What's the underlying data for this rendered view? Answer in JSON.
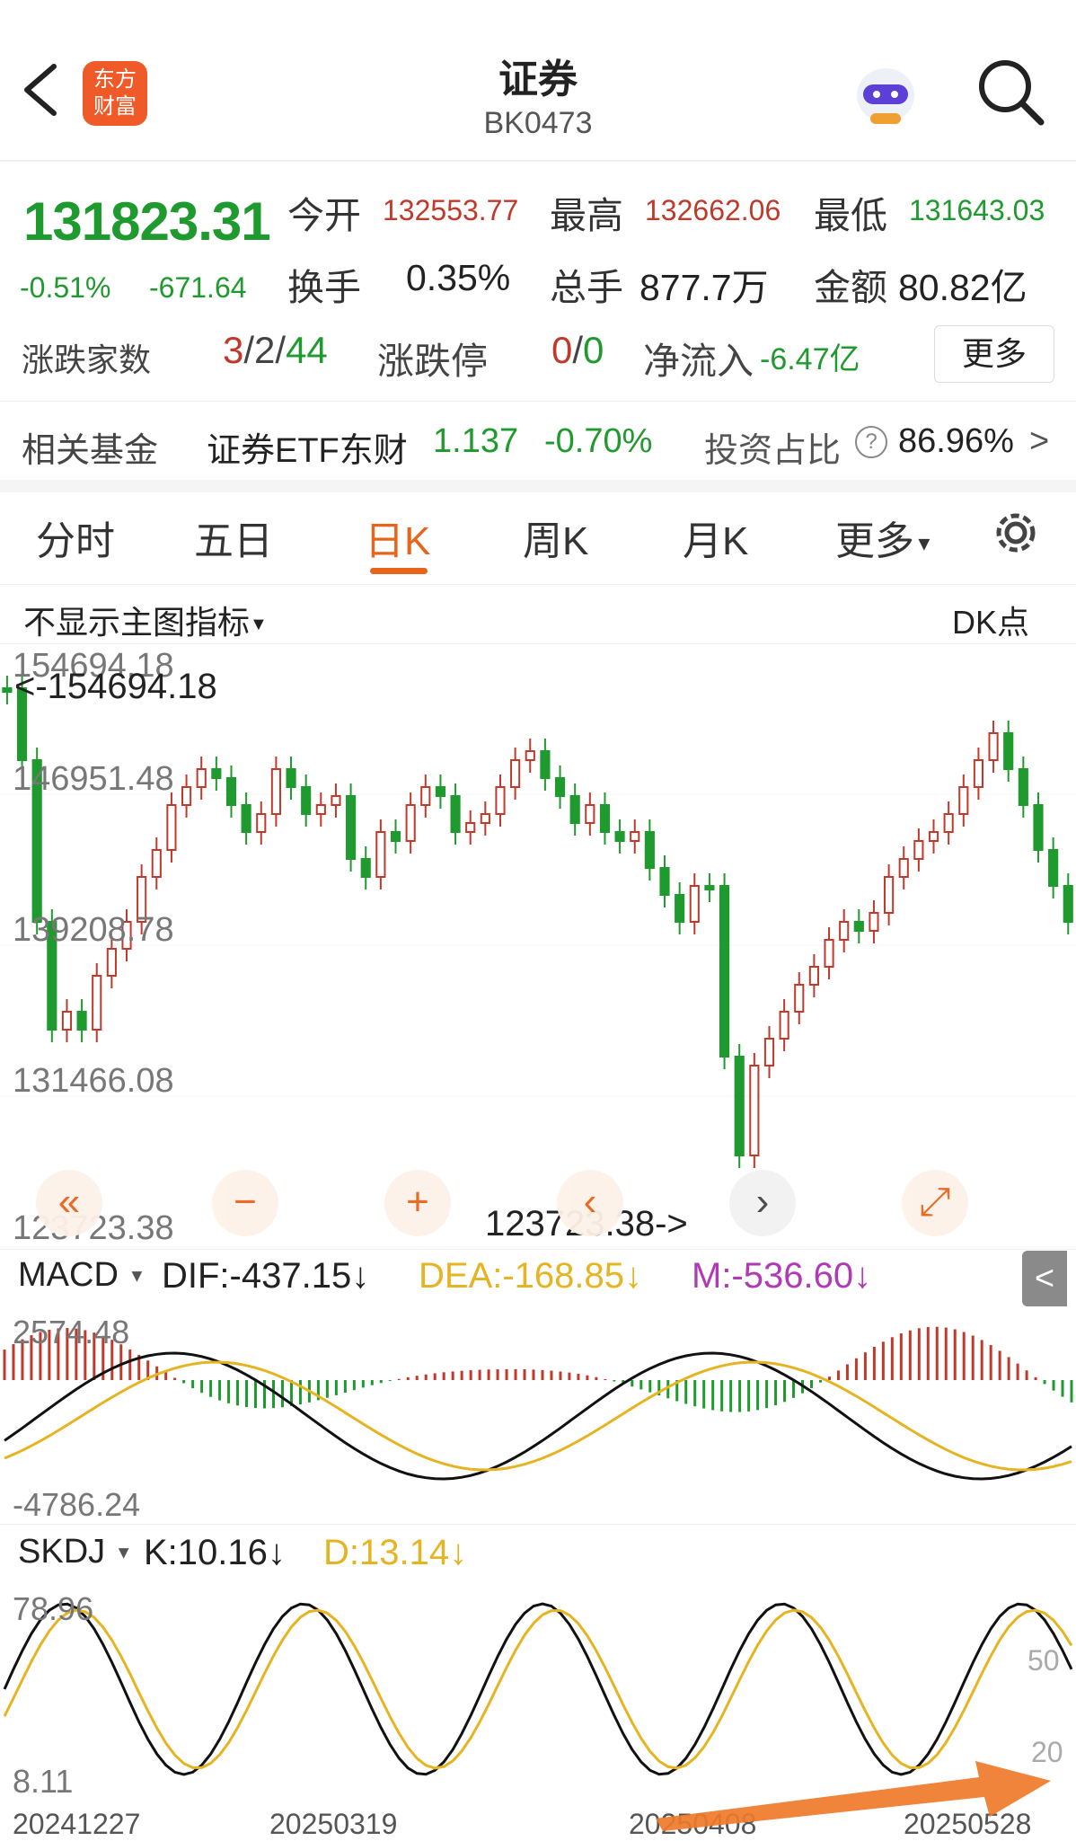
{
  "header": {
    "back_icon": "chevron-left-icon",
    "logo_text_1": "东方",
    "logo_text_2": "财富",
    "title": "证券",
    "code": "BK0473",
    "robot_icon": "robot-avatar-icon",
    "search_icon": "search-icon"
  },
  "quote": {
    "price": "131823.31",
    "change_pct": "-0.51%",
    "change_val": "-671.64",
    "open_label": "今开",
    "open_value": "132553.77",
    "high_label": "最高",
    "high_value": "132662.06",
    "low_label": "最低",
    "low_value": "131643.03",
    "turnover_label": "换手",
    "turnover_value": "0.35%",
    "volume_label": "总手",
    "volume_value": "877.7万",
    "amount_label": "金额",
    "amount_value": "80.82亿",
    "updown_label": "涨跌家数",
    "up_count": "3",
    "sep1": "/",
    "flat_count": "2",
    "sep2": "/",
    "down_count": "44",
    "limit_label": "涨跌停",
    "limit_up": "0",
    "sep3": "/",
    "limit_down": "0",
    "netflow_label": "净流入",
    "netflow_value": "-6.47亿",
    "more_button": "更多"
  },
  "fund": {
    "label": "相关基金",
    "name": "证券ETF东财",
    "price": "1.137",
    "change": "-0.70%",
    "ratio_label": "投资占比",
    "ratio_value": "86.96%",
    "arrow": ">"
  },
  "tabs": [
    "分时",
    "五日",
    "日K",
    "周K",
    "月K",
    "更多"
  ],
  "active_tab": "日K",
  "settings_icon": "gear-icon",
  "kchart": {
    "indicator_select": "不显示主图指标",
    "dk_label": "DK点",
    "y_labels": [
      "154694.18",
      "146951.48",
      "139208.78",
      "131466.08",
      "123723.38"
    ],
    "high_marker": "<-154694.18",
    "low_marker": "123723.38->",
    "controls": [
      "«",
      "−",
      "+",
      "‹",
      "›",
      "⤢"
    ]
  },
  "macd": {
    "label": "MACD",
    "dif": "DIF:-437.15↓",
    "dea": "DEA:-168.85↓",
    "m": "M:-536.60↓",
    "y_top": "2574.48",
    "y_bottom": "-4786.24",
    "side_button": "<"
  },
  "skdj": {
    "label": "SKDJ",
    "k": "K:10.16↓",
    "d": "D:13.14↓",
    "y_top": "78.96",
    "y_bottom": "8.11",
    "lvl50": "50",
    "lvl20": "20"
  },
  "dates": [
    "20241227",
    "20250319",
    "20250408",
    "20250528"
  ],
  "colors": {
    "up": "#c0392b",
    "down": "#1f9a2e",
    "accent": "#e8641b",
    "dea": "#e6b422",
    "m": "#b03ab5"
  }
}
